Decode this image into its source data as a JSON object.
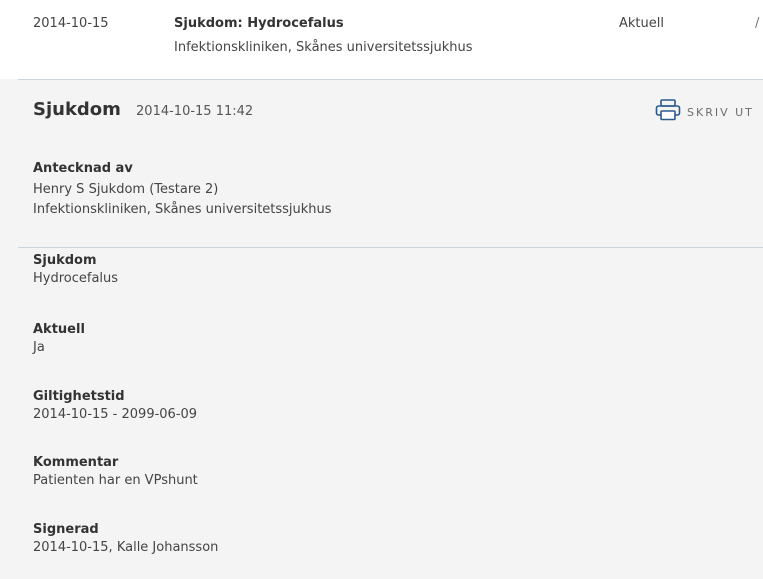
{
  "list_row": {
    "date": "2014-10-15",
    "title": "Sjukdom: Hydrocefalus",
    "unit": "Infektionskliniken, Skånes universitetssjukhus",
    "status": "Aktuell",
    "extra": "/"
  },
  "detail": {
    "title": "Sjukdom",
    "timestamp": "2014-10-15 11:42",
    "print_label": "SKRIV UT",
    "noted_by": {
      "label": "Antecknad av",
      "name": "Henry S Sjukdom (Testare 2)",
      "unit": "Infektionskliniken, Skånes universitetssjukhus"
    },
    "fields": [
      {
        "label": "Sjukdom",
        "value": "Hydrocefalus"
      },
      {
        "label": "Aktuell",
        "value": "Ja"
      },
      {
        "label": "Giltighetstid",
        "value": "2014-10-15 - 2099-06-09"
      },
      {
        "label": "Kommentar",
        "value": "Patienten har en VPshunt"
      },
      {
        "label": "Signerad",
        "value": "2014-10-15, Kalle Johansson"
      }
    ]
  }
}
